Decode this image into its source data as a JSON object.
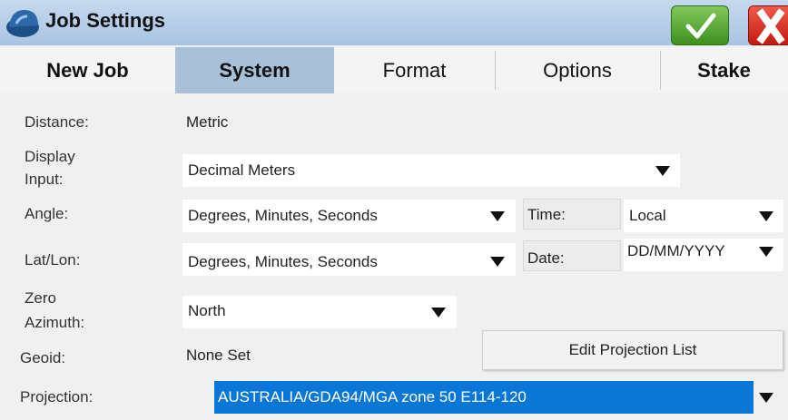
{
  "window": {
    "title": "Job Settings",
    "ok_icon": "checkmark-icon",
    "close_icon": "close-x-icon",
    "colors": {
      "title_bar": "#b7cfe9",
      "ok": "#4f9f2e",
      "close": "#d9261a",
      "active_tab": "#a8c0d8",
      "selection": "#0a77d6"
    }
  },
  "tabs": [
    {
      "label": "New Job"
    },
    {
      "label": "System",
      "active": true
    },
    {
      "label": "Format"
    },
    {
      "label": "Options"
    },
    {
      "label": "Stake"
    }
  ],
  "form": {
    "distance": {
      "label": "Distance:",
      "value": "Metric"
    },
    "display_input": {
      "label_line1": "Display",
      "label_line2": "Input:",
      "value": "Decimal Meters"
    },
    "angle": {
      "label": "Angle:",
      "value": "Degrees, Minutes, Seconds"
    },
    "time": {
      "label": "Time:",
      "value": "Local"
    },
    "latlon": {
      "label": "Lat/Lon:",
      "value": "Degrees, Minutes, Seconds"
    },
    "date": {
      "label": "Date:",
      "value": "DD/MM/YYYY"
    },
    "zero_azimuth": {
      "label_line1": "Zero",
      "label_line2": "Azimuth:",
      "value": "North"
    },
    "geoid": {
      "label": "Geoid:",
      "value": "None Set"
    },
    "edit_projection_button": "Edit Projection List",
    "projection": {
      "label": "Projection:",
      "value": "AUSTRALIA/GDA94/MGA zone 50 E114-120"
    }
  }
}
